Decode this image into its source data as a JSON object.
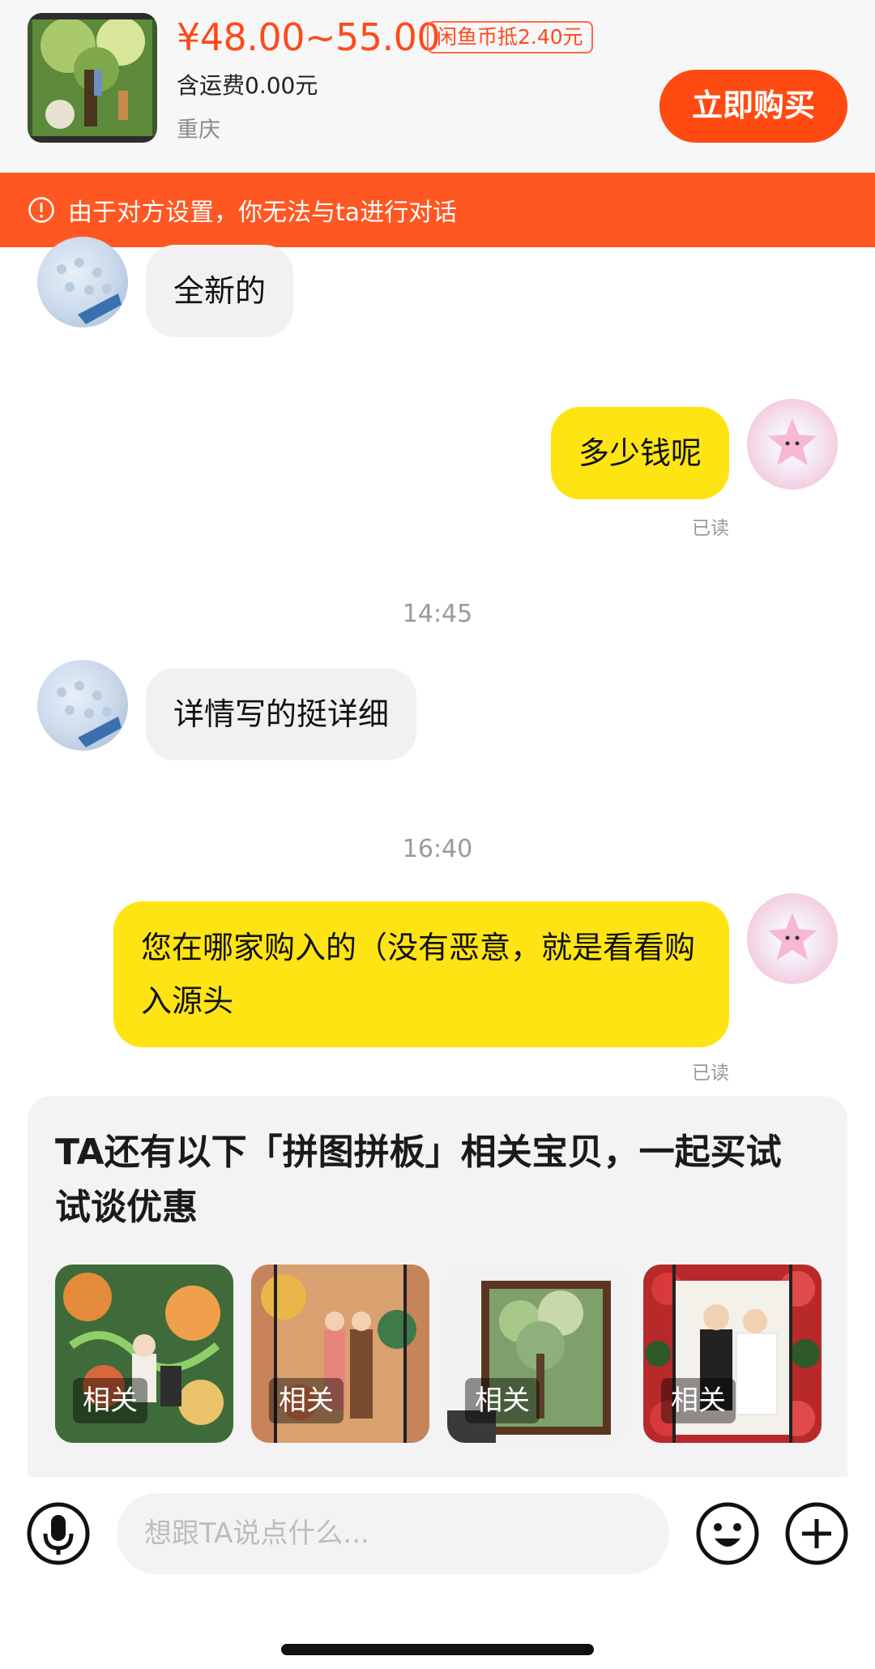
{
  "product": {
    "price": "¥48.00~55.00",
    "coin_badge": "闲鱼币抵2.40元",
    "shipping": "含运费0.00元",
    "location": "重庆",
    "buy_label": "立即购买"
  },
  "warning": {
    "text": "由于对方设置，你无法与ta进行对话",
    "icon": "alert-circle-icon"
  },
  "messages": [
    {
      "from": "seller",
      "text": "全新的"
    },
    {
      "from": "me",
      "text": "多少钱呢",
      "status": "已读"
    },
    {
      "from": "time",
      "text": "14:45"
    },
    {
      "from": "seller",
      "text": "详情写的挺详细"
    },
    {
      "from": "time",
      "text": "16:40"
    },
    {
      "from": "me",
      "text": "您在哪家购入的（没有恶意，就是看看购入源头",
      "status": "已读"
    }
  ],
  "recommend": {
    "title": "TA还有以下「拼图拼板」相关宝贝，一起买试试谈优惠",
    "items": [
      {
        "tag": "相关"
      },
      {
        "tag": "相关"
      },
      {
        "tag": "相关"
      },
      {
        "tag": "相关"
      }
    ]
  },
  "input": {
    "placeholder": "想跟TA说点什么..."
  },
  "colors": {
    "accent": "#ff4a12",
    "warning_bg": "#ff5722",
    "out_bubble": "#ffe414",
    "in_bubble": "#f1f1f3"
  }
}
